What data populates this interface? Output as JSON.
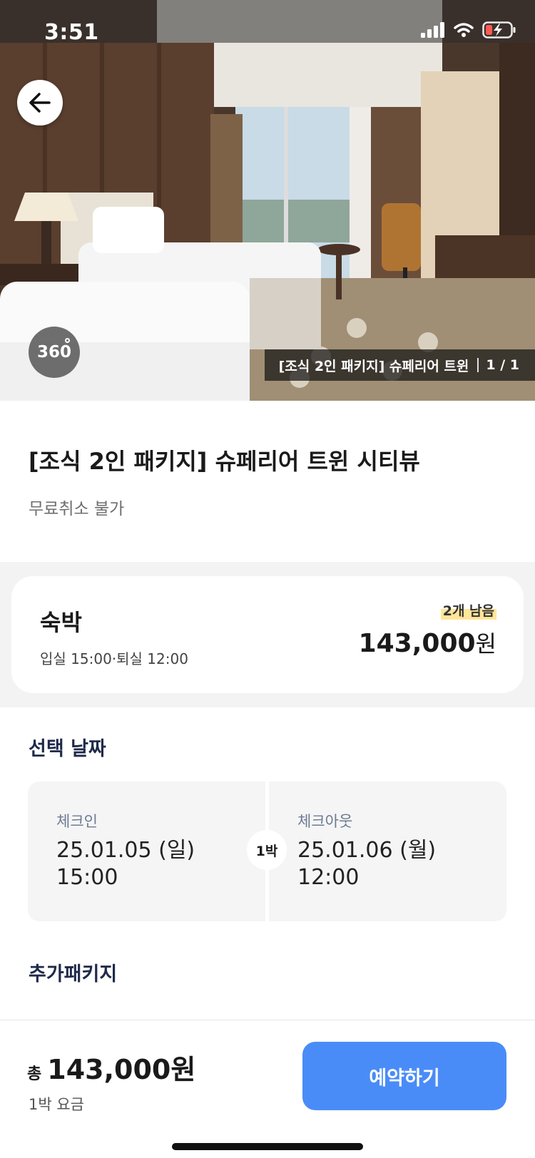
{
  "status_bar": {
    "time": "3:51"
  },
  "hero": {
    "badge": "360",
    "caption": "[조식 2인 패키지] 슈페리어 트윈",
    "counter": "1 / 1"
  },
  "room": {
    "title": "[조식 2인 패키지] 슈페리어 트윈 시티뷰",
    "cancel_policy": "무료취소 불가"
  },
  "stay": {
    "label": "숙박",
    "time": "입실 15:00·퇴실 12:00",
    "remaining": "2개 남음",
    "price": "143,000",
    "currency": "원"
  },
  "dates": {
    "heading": "선택 날짜",
    "checkin_label": "체크인",
    "checkin_date": "25.01.05 (일)",
    "checkin_time": "15:00",
    "nights": "1박",
    "checkout_label": "체크아웃",
    "checkout_date": "25.01.06 (월)",
    "checkout_time": "12:00"
  },
  "extra": {
    "heading": "추가패키지"
  },
  "bottom": {
    "total_prefix": "총",
    "total": "143,000원",
    "per_night": "1박 요금",
    "book_button": "예약하기"
  },
  "colors": {
    "accent": "#4a8cf7",
    "highlight": "#ffe69a",
    "section_bg": "#f3f3f3",
    "heading": "#1f2a4a"
  }
}
